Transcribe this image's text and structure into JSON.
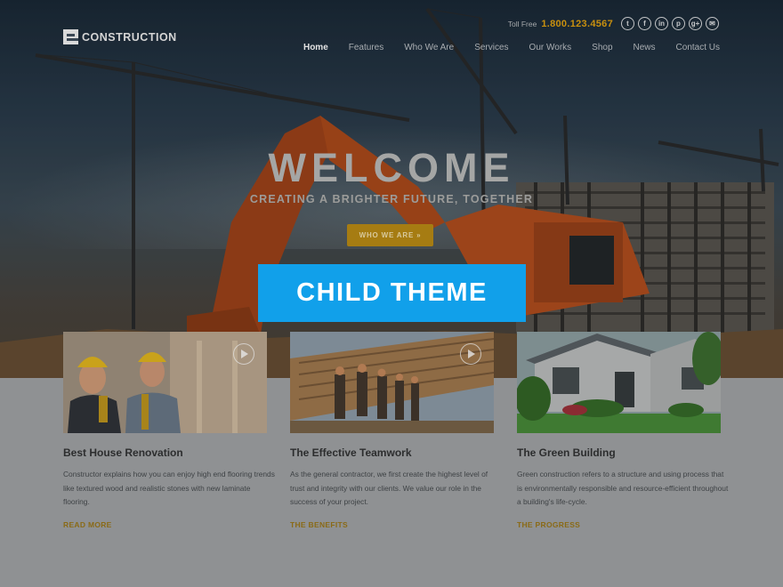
{
  "header": {
    "logo_text": "CONSTRUCTION",
    "tollfree_label": "Toll Free",
    "tollfree_number": "1.800.123.4567",
    "socials": [
      {
        "icon": "twitter-icon",
        "glyph": "t"
      },
      {
        "icon": "facebook-icon",
        "glyph": "f"
      },
      {
        "icon": "linkedin-icon",
        "glyph": "in"
      },
      {
        "icon": "pinterest-icon",
        "glyph": "p"
      },
      {
        "icon": "google-plus-icon",
        "glyph": "g+"
      },
      {
        "icon": "email-icon",
        "glyph": "✉"
      }
    ],
    "nav": [
      "Home",
      "Features",
      "Who We Are",
      "Services",
      "Our Works",
      "Shop",
      "News",
      "Contact Us"
    ],
    "nav_active": "Home"
  },
  "hero": {
    "title": "WELCOME",
    "subtitle": "CREATING A BRIGHTER FUTURE, TOGETHER",
    "cta_label": "WHO WE ARE »"
  },
  "badge": "CHILD THEME",
  "cards": [
    {
      "title": "Best House Renovation",
      "text": "Constructor explains how you can enjoy high end flooring trends like textured wood and realistic stones with new laminate flooring.",
      "link": "READ MORE",
      "has_play": true
    },
    {
      "title": "The Effective Teamwork",
      "text": "As the general contractor, we first create the highest level of trust and integrity with our clients. We value our role in the success of your project.",
      "link": "THE BENEFITS",
      "has_play": true
    },
    {
      "title": "The Green Building",
      "text": "Green construction refers to a structure and using process that is environmentally responsible and resource-efficient throughout a building's life-cycle.",
      "link": "THE PROGRESS",
      "has_play": false
    }
  ],
  "colors": {
    "accent": "#c8900f",
    "badge": "#11a0ea",
    "cta": "#a67c12"
  }
}
